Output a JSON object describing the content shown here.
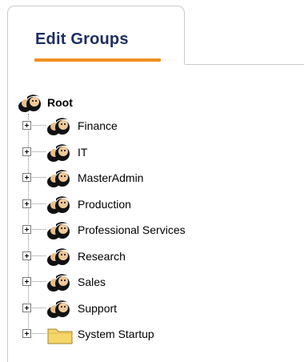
{
  "tab": {
    "label": "Edit Groups"
  },
  "tree": {
    "root": {
      "label": "Root",
      "icon": "group-icon"
    },
    "items": [
      {
        "label": "Finance",
        "icon": "group-icon"
      },
      {
        "label": "IT",
        "icon": "group-icon"
      },
      {
        "label": "MasterAdmin",
        "icon": "group-icon"
      },
      {
        "label": "Production",
        "icon": "group-icon"
      },
      {
        "label": "Professional Services",
        "icon": "group-icon"
      },
      {
        "label": "Research",
        "icon": "group-icon"
      },
      {
        "label": "Sales",
        "icon": "group-icon"
      },
      {
        "label": "Support",
        "icon": "group-icon"
      },
      {
        "label": "System Startup",
        "icon": "folder-icon"
      }
    ]
  },
  "colors": {
    "tab_text": "#1d2f64",
    "tab_underline": "#f0901f",
    "border": "#c9c9c9",
    "folder": "#f6d56a"
  }
}
